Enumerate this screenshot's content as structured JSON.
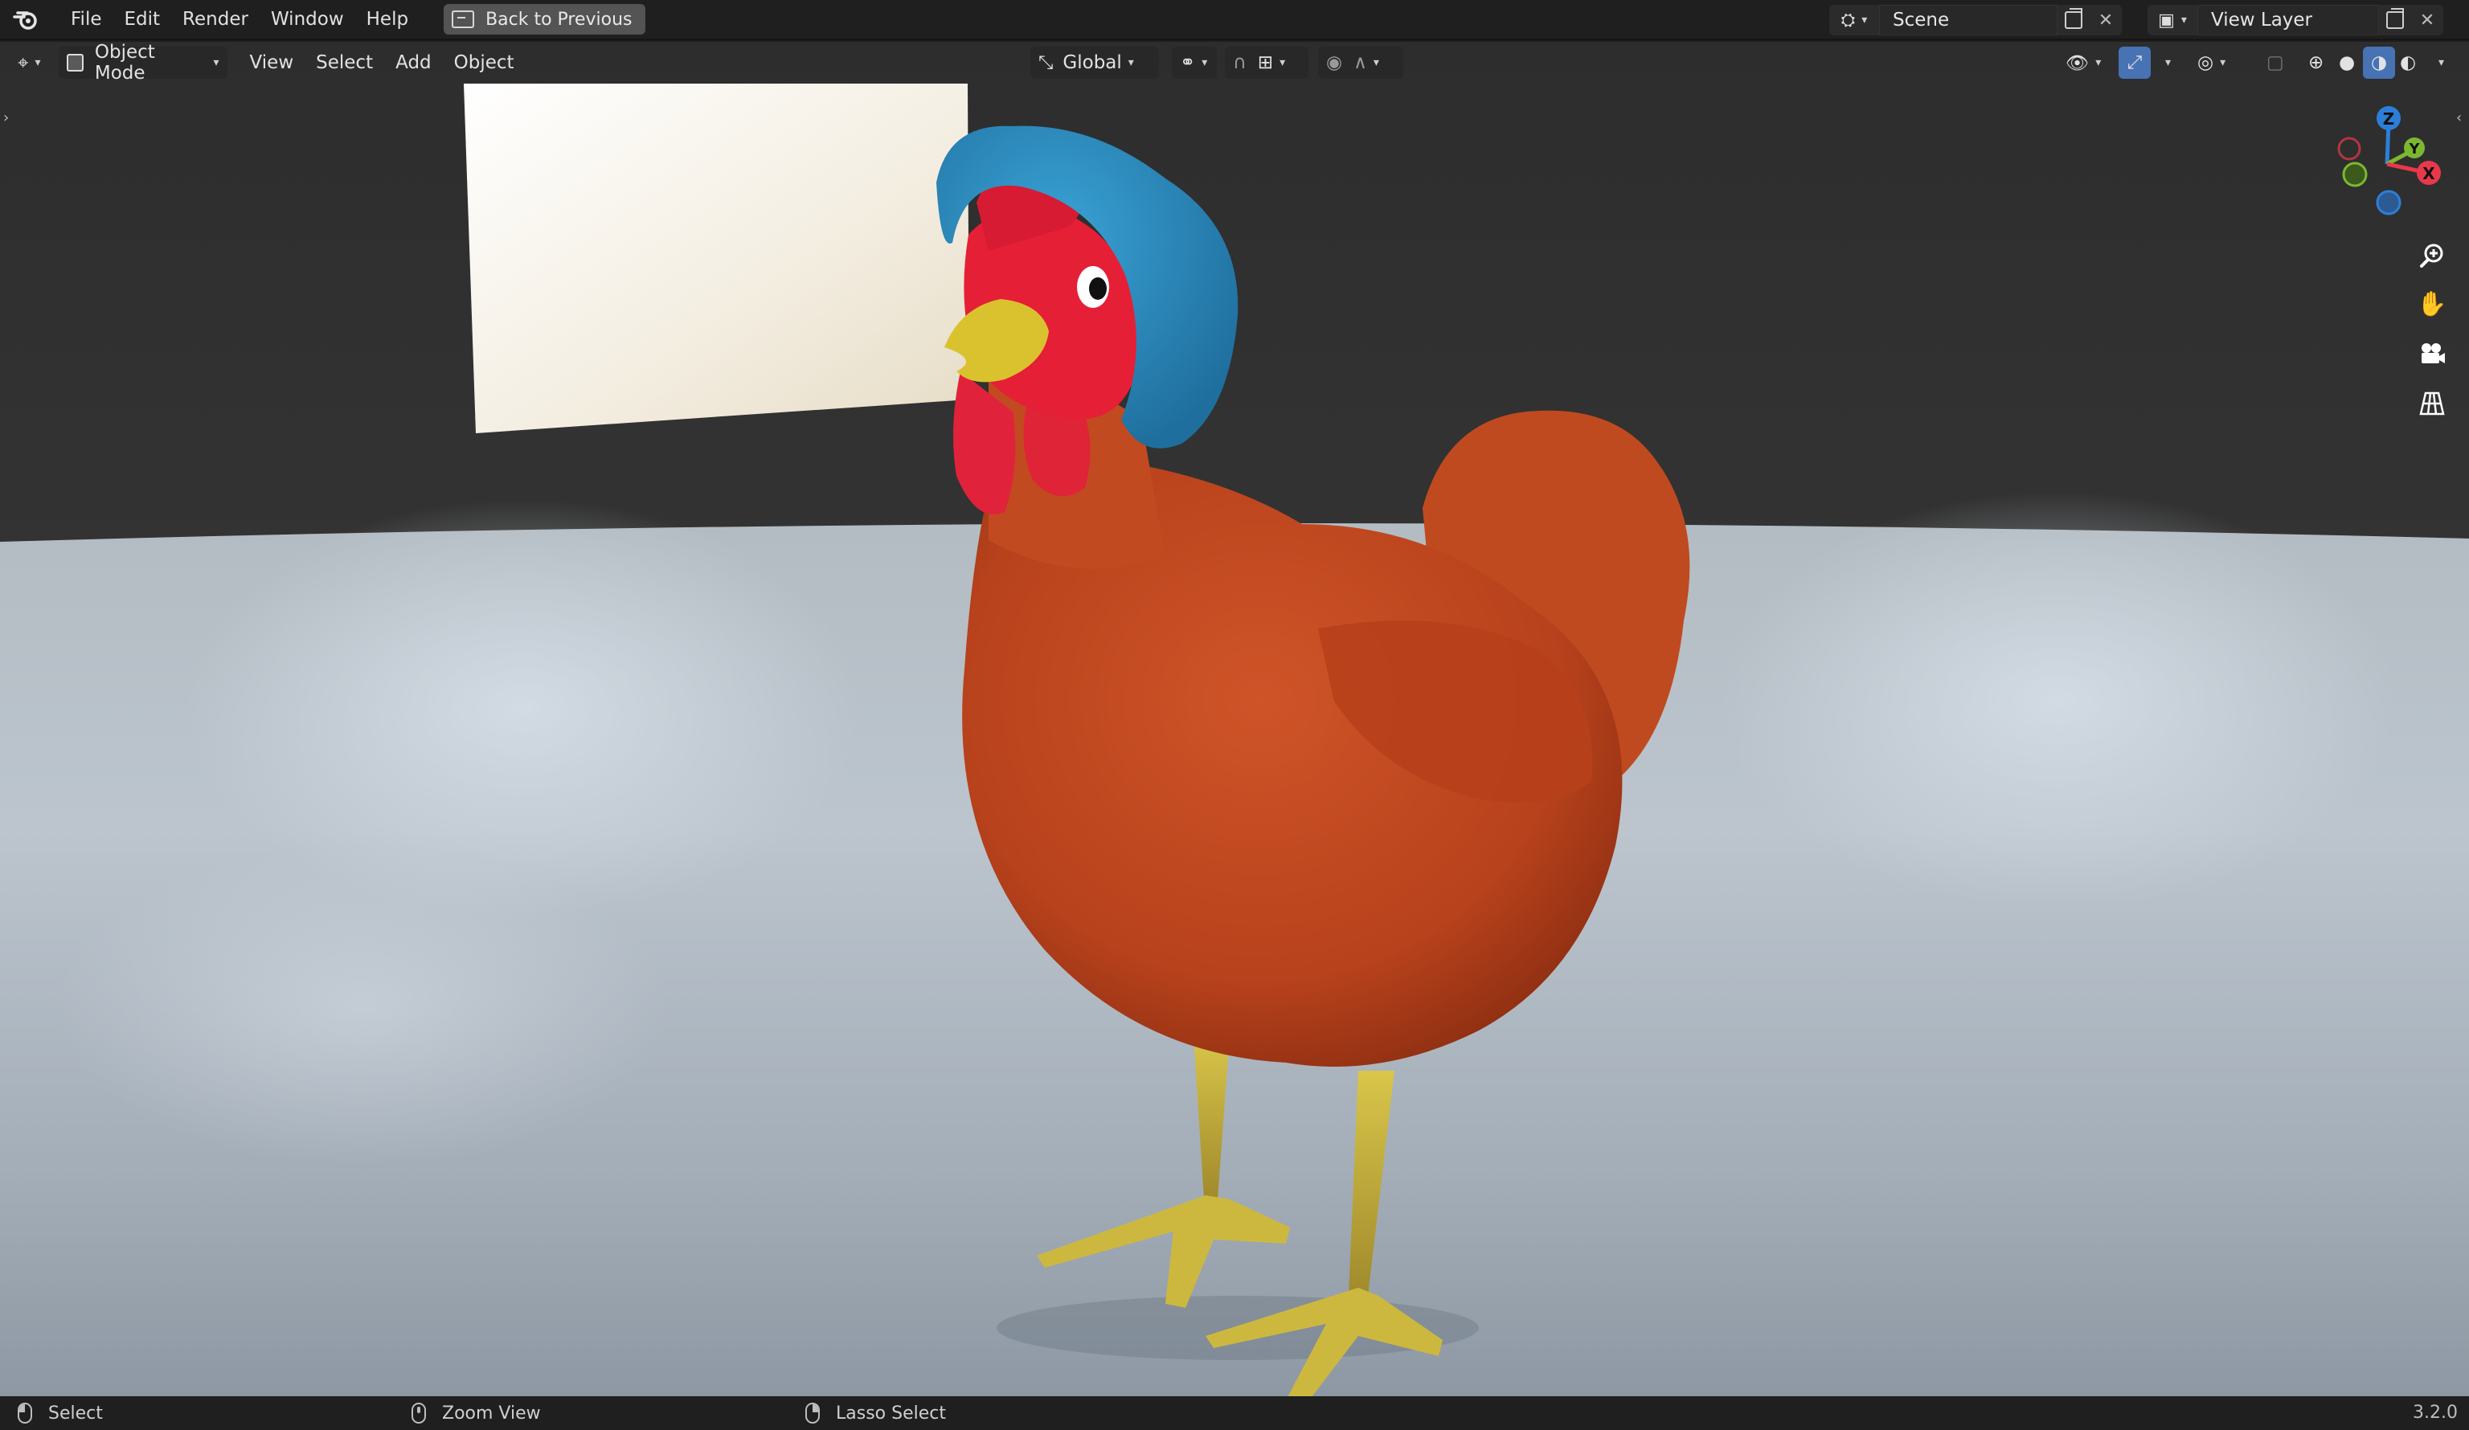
{
  "topbar": {
    "menu": [
      "File",
      "Edit",
      "Render",
      "Window",
      "Help"
    ],
    "back_button": "Back to Previous",
    "scene_label": "Scene",
    "view_layer_label": "View Layer"
  },
  "viewport_header": {
    "mode": "Object Mode",
    "menus": [
      "View",
      "Select",
      "Add",
      "Object"
    ],
    "transform_orientation": "Global"
  },
  "gizmo": {
    "axes": [
      "Z",
      "Y",
      "X"
    ]
  },
  "statusbar": {
    "left_click": "Select",
    "middle_click": "Zoom View",
    "right_click": "Lasso Select",
    "version": "3.2.0"
  },
  "colors": {
    "topbar_bg": "#1f1f1f",
    "backdrop_top": "#2b2b2b",
    "floor": "#a9b3bd",
    "hen_body": "#c2471f",
    "bonnet": "#2c8fc4",
    "comb": "#e0233a",
    "beak_legs": "#d9c64a",
    "axis_x": "#e8394a",
    "axis_y": "#7cb82f",
    "axis_z": "#2c7fd8",
    "active_blue": "#4772b3"
  }
}
